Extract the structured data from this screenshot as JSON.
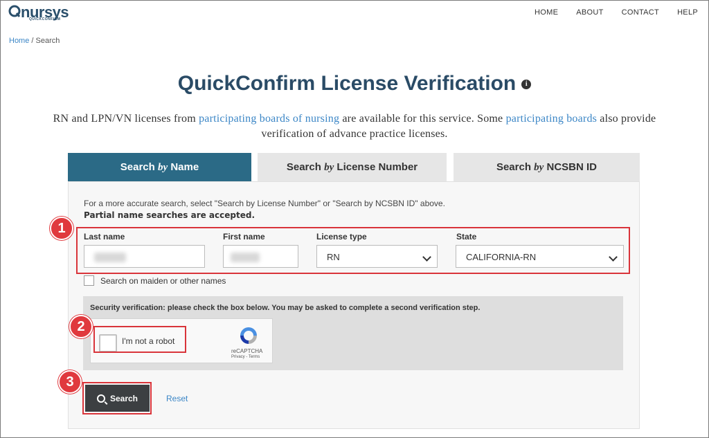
{
  "header": {
    "logo_text": "nursys",
    "logo_sub": "QUICKCONFIRM",
    "nav": [
      "HOME",
      "ABOUT",
      "CONTACT",
      "HELP"
    ]
  },
  "breadcrumb": {
    "home": "Home",
    "separator": "/",
    "current": "Search"
  },
  "title": "QuickConfirm License Verification",
  "intro": {
    "p1": "RN and LPN/VN licenses from",
    "link1": "participating boards of nursing",
    "p2": "are available for this service. Some",
    "link2": "participating boards",
    "p3": "also provide",
    "line2": "verification of advance practice licenses."
  },
  "tabs": [
    {
      "pre": "Search",
      "by": "by",
      "post": "Name"
    },
    {
      "pre": "Search",
      "by": "by",
      "post": "License Number"
    },
    {
      "pre": "Search",
      "by": "by",
      "post": "NCSBN ID"
    }
  ],
  "form": {
    "hint": "For a more accurate search, select \"Search by License Number\" or \"Search by NCSBN ID\" above.",
    "hint_bold": "Partial name searches are accepted.",
    "last_name_label": "Last name",
    "first_name_label": "First name",
    "license_type_label": "License type",
    "license_type_value": "RN",
    "state_label": "State",
    "state_value": "CALIFORNIA-RN",
    "maiden_label": "Search on maiden or other names"
  },
  "security": {
    "text": "Security verification: please check the box below. You may be asked to complete a second verification step.",
    "captcha_label": "I'm not a robot",
    "captcha_brand": "reCAPTCHA",
    "captcha_terms": "Privacy - Terms"
  },
  "actions": {
    "search": "Search",
    "reset": "Reset"
  },
  "badges": [
    "1",
    "2",
    "3"
  ],
  "colors": {
    "accent": "#2b6a86",
    "highlight": "#d9343a",
    "link": "#3b86c6"
  }
}
